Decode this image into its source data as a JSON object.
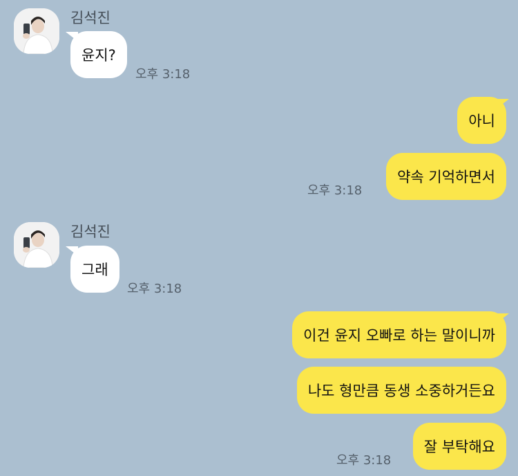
{
  "chat": {
    "messages": [
      {
        "sender": "김석진",
        "text": "윤지?",
        "time": "오후 3:18"
      },
      {
        "sender": "me",
        "text": "아니"
      },
      {
        "sender": "me",
        "text": "약속 기억하면서",
        "time": "오후 3:18"
      },
      {
        "sender": "김석진",
        "text": "그래",
        "time": "오후 3:18"
      },
      {
        "sender": "me",
        "text": "이건 윤지 오빠로 하는 말이니까"
      },
      {
        "sender": "me",
        "text": "나도 형만큼 동생 소중하거든요"
      },
      {
        "sender": "me",
        "text": "잘 부탁해요",
        "time": "오후 3:18"
      }
    ]
  },
  "colors": {
    "background": "#abbfd0",
    "outgoing": "#fbe64b",
    "incoming": "#ffffff"
  },
  "icons": {
    "avatar": "profile-photo"
  }
}
